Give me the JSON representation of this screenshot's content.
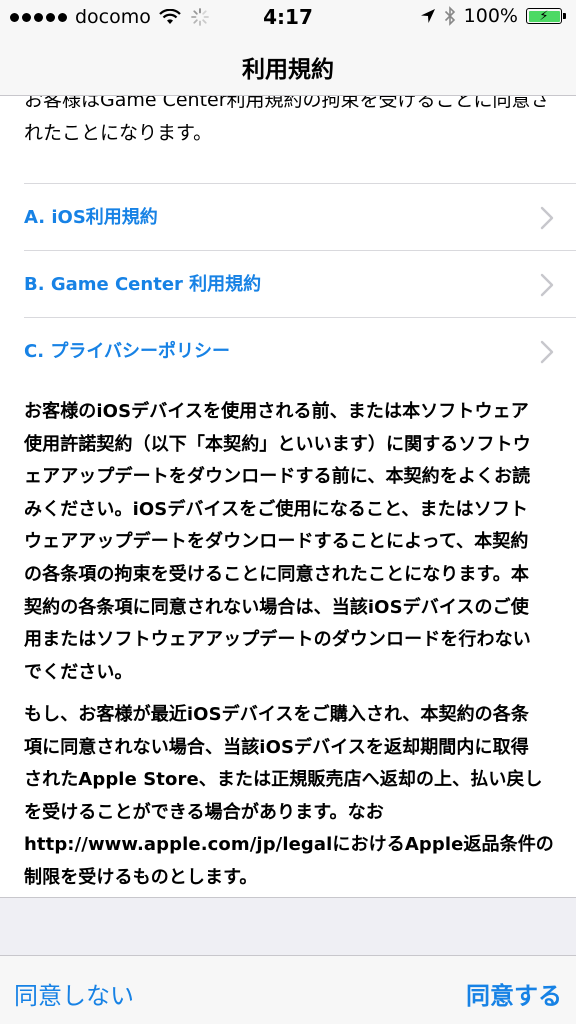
{
  "status_bar": {
    "carrier": "docomo",
    "time": "4:17",
    "battery": "100%",
    "battery_level": 1.0
  },
  "nav": {
    "title": "利用規約"
  },
  "intro_text": "お客様はGame Center利用規約の拘束を受けることに同意さ\nれたことになります。",
  "rows": [
    {
      "label": "A. iOS利用規約"
    },
    {
      "label": "B. Game Center 利用規約"
    },
    {
      "label": "C. プライバシーポリシー"
    }
  ],
  "paragraphs": [
    "お客様のiOSデバイスを使用される前、または本ソフトウェア\n使用許諾契約（以下「本契約」といいます）に関するソフトウ\nェアアップデートをダウンロードする前に、本契約をよくお読\nみください。iOSデバイスをご使用になること、またはソフト\nウェアアップデートをダウンロードすることによって、本契約\nの各条項の拘束を受けることに同意されたことになります。本\n契約の各条項に同意されない場合は、当該iOSデバイスのご使\n用またはソフトウェアアップデートのダウンロードを行わない\nでください。",
    "もし、お客様が最近iOSデバイスをご購入され、本契約の各条\n項に同意されない場合、当該iOSデバイスを返却期間内に取得\nされたApple Store、または正規販売店へ返却の上、払い戻し\nを受けることができる場合があります。なお\nhttp://www.apple.com/jp/legalにおけるApple返品条件の\n制限を受けるものとします。"
  ],
  "toolbar": {
    "disagree": "同意しない",
    "agree": "同意する"
  },
  "colors": {
    "accent": "#1782e5",
    "battery": "#4cd964"
  },
  "icons": [
    "signal-dots-icon",
    "wifi-icon",
    "loading-spinner-icon",
    "location-arrow-icon",
    "bluetooth-icon",
    "battery-icon",
    "chevron-right-icon"
  ]
}
